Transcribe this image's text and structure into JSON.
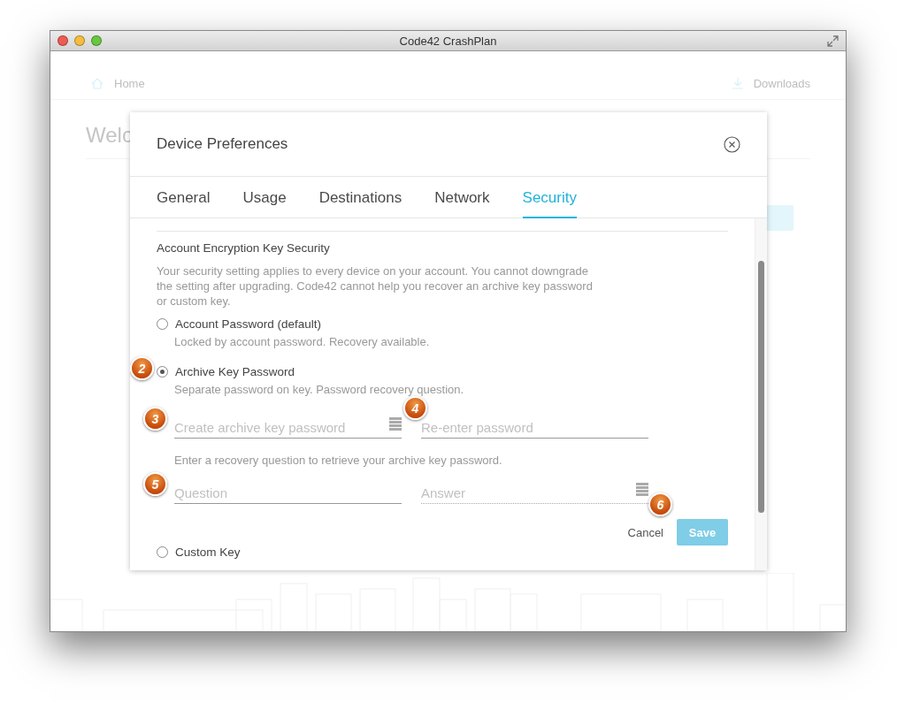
{
  "window": {
    "title": "Code42 CrashPlan"
  },
  "background": {
    "nav": [
      {
        "kind": "home",
        "label": "Home"
      },
      {
        "kind": "download",
        "label": "Downloads"
      }
    ],
    "heading": "Welc"
  },
  "dialog": {
    "title": "Device Preferences",
    "tabs": [
      {
        "label": "General",
        "selected": false
      },
      {
        "label": "Usage",
        "selected": false
      },
      {
        "label": "Destinations",
        "selected": false
      },
      {
        "label": "Network",
        "selected": false
      },
      {
        "label": "Security",
        "selected": true
      }
    ],
    "section_title": "Account Encryption Key Security",
    "description": "Your security setting applies to every device on your account. You cannot downgrade the setting after upgrading. Code42 cannot help you recover an archive key password or custom key.",
    "options": [
      {
        "label": "Account Password (default)",
        "note": "Locked by account password. Recovery available.",
        "selected": false
      },
      {
        "label": "Archive Key Password",
        "note": "Separate password on key. Password recovery question.",
        "selected": true,
        "badge": "2",
        "password_fields": [
          {
            "placeholder": "Create archive key password",
            "key_icon": true,
            "dotted": false,
            "badge": "3"
          },
          {
            "placeholder": "Re-enter password",
            "key_icon": false,
            "dotted": false,
            "badge": "4"
          }
        ],
        "question_note": "Enter a recovery question to retrieve your archive key password.",
        "question_fields": [
          {
            "placeholder": "Question",
            "key_icon": false,
            "dotted": false,
            "badge": "5"
          },
          {
            "placeholder": "Answer",
            "key_icon": true,
            "dotted": true
          }
        ]
      },
      {
        "label": "Custom Key",
        "selected": false
      }
    ],
    "buttons": {
      "cancel": "Cancel",
      "save": "Save",
      "save_disabled": true,
      "badge": "6"
    }
  }
}
